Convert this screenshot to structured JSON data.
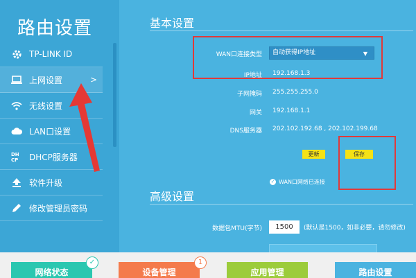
{
  "sidebar": {
    "title": "路由设置",
    "items": [
      {
        "label": "TP-LINK ID",
        "icon": "gear-icon"
      },
      {
        "label": "上网设置",
        "icon": "laptop-icon",
        "chevron": ">"
      },
      {
        "label": "无线设置",
        "icon": "wifi-icon"
      },
      {
        "label": "LAN口设置",
        "icon": "cloud-icon"
      },
      {
        "label": "DHCP服务器",
        "icon": "dhcp-icon"
      },
      {
        "label": "软件升级",
        "icon": "upgrade-icon"
      },
      {
        "label": "修改管理员密码",
        "icon": "pencil-icon"
      }
    ]
  },
  "basic": {
    "title": "基本设置",
    "wan_type_label": "WAN口连接类型",
    "wan_type_value": "自动获得IP地址",
    "ip_label": "IP地址",
    "ip_value": "192.168.1.3",
    "mask_label": "子网掩码",
    "mask_value": "255.255.255.0",
    "gateway_label": "网关",
    "gateway_value": "192.168.1.1",
    "dns_label": "DNS服务器",
    "dns_value": "202.102.192.68 , 202.102.199.68",
    "refresh_button": "更新",
    "save_button": "保存",
    "wan_status": "WAN口网络已连接"
  },
  "advanced": {
    "title": "高级设置",
    "mtu_label": "数据包MTU(字节)",
    "mtu_value": "1500",
    "mtu_hint": "(默认是1500，如非必要，请勿修改)"
  },
  "bottom_tiles": [
    {
      "label": "网络状态",
      "color": "#2bc7b0",
      "badge": "✓"
    },
    {
      "label": "设备管理",
      "color": "#f47b4c",
      "badge": "1"
    },
    {
      "label": "应用管理",
      "color": "#9ccc3b"
    },
    {
      "label": "路由设置",
      "color": "#4ab3e0"
    }
  ],
  "colors": {
    "accent": "#4ab3e0",
    "sidebar": "#3ca6d6",
    "highlight": "#e03a3a",
    "button": "#f5e215"
  }
}
